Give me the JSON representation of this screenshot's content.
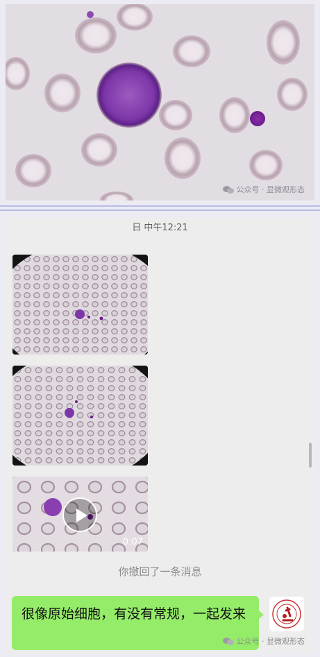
{
  "watermark_text": "公众号 · 显微观形态",
  "chat": {
    "timestamp": "日 中午12:21",
    "video_duration": "0:07",
    "recall_notice": "你撤回了一条消息",
    "message_text": "很像原始细胞，有没有常规，一起发来"
  },
  "icons": {
    "wechat": "wechat-logo-icon",
    "play": "play-icon",
    "avatar": "microscope-logo-avatar"
  },
  "colors": {
    "bubble": "#95ec69",
    "background": "#ededed",
    "cell": "#8a3fb0",
    "divider": "#b9bbe6"
  }
}
